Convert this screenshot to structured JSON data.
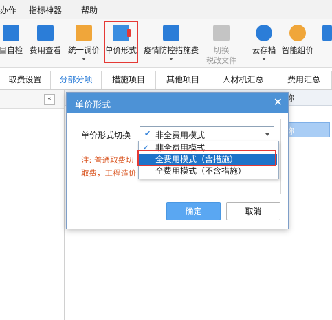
{
  "menubar": {
    "items": [
      "办作",
      "指标神器",
      "帮助"
    ]
  },
  "toolbar": {
    "items": [
      {
        "label": "目自检",
        "icon": "self-check-icon",
        "color": "#e07a1f"
      },
      {
        "label": "费用查看",
        "icon": "fee-view-icon",
        "color": "#2b7dd8"
      },
      {
        "label": "统一调价",
        "icon": "price-adjust-icon",
        "color": "#e07a1f"
      },
      {
        "label": "单价形式",
        "icon": "unit-price-form-icon",
        "color": "#2b7dd8"
      },
      {
        "label": "疫情防控措施费",
        "icon": "epidemic-measure-icon",
        "color": "#2b7dd8"
      },
      {
        "label": "切换",
        "label2": "税改文件",
        "icon": "switch-tax-icon",
        "color": "#9a9a9a"
      },
      {
        "label": "云存档",
        "icon": "cloud-archive-icon",
        "color": "#2b7dd8"
      },
      {
        "label": "智能组价",
        "icon": "smart-pricing-icon",
        "color": "#e07a1f"
      }
    ]
  },
  "tabs": [
    {
      "label": "取费设置",
      "active": false
    },
    {
      "label": "分部分项",
      "active": true
    },
    {
      "label": "措施项目",
      "active": false
    },
    {
      "label": "其他项目",
      "active": false
    },
    {
      "label": "人材机汇总",
      "active": false
    },
    {
      "label": "费用汇总",
      "active": false
    }
  ],
  "left_pane": {
    "collapse_label": "«"
  },
  "grid": {
    "header_fragment": "称",
    "selected_row_fragment": "称"
  },
  "dialog": {
    "title": "单价形式",
    "close_label": "✕",
    "field_label": "单价形式切换",
    "selected_value": "非全费用模式",
    "note": "注: 普通取费切\n取费，工程造价",
    "options": [
      {
        "label": "非全费用模式",
        "checked": true,
        "hover": false
      },
      {
        "label": "全费用模式（含措施）",
        "checked": false,
        "hover": true
      },
      {
        "label": "全费用模式（不含措施）",
        "checked": false,
        "hover": false
      }
    ],
    "ok_label": "确定",
    "cancel_label": "取消"
  },
  "colors": {
    "accent": "#2b7dd8",
    "dialog_title": "#4d92d6",
    "highlight": "#e53935",
    "note": "#d9531e"
  }
}
